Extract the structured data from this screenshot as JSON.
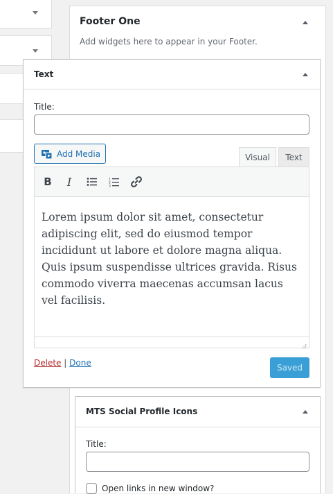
{
  "sidebar": {
    "title": "Footer One",
    "description": "Add widgets here to appear in your Footer."
  },
  "text_widget": {
    "title": "Text",
    "title_label": "Title:",
    "title_value": "",
    "add_media_label": "Add Media",
    "tabs": [
      "Visual",
      "Text"
    ],
    "active_tab": "Visual",
    "toolbar": [
      "bold-icon",
      "italic-icon",
      "bulleted-list-icon",
      "numbered-list-icon",
      "link-icon"
    ],
    "content": "Lorem ipsum dolor sit amet, consectetur adipiscing elit, sed do eiusmod tempor incididunt ut labore et dolore magna aliqua. Quis ipsum suspendisse ultrices gravida. Risus commodo viverra maecenas accumsan lacus vel facilisis.",
    "delete_label": "Delete",
    "separator": "|",
    "done_label": "Done",
    "saved_label": "Saved"
  },
  "mts_widget": {
    "title": "MTS Social Profile Icons",
    "title_label": "Title:",
    "title_value": "",
    "checkbox_label": "Open links in new window?",
    "checkbox_checked": false
  },
  "colors": {
    "accent": "#2271b1",
    "saved_button": "#3a9fd6",
    "delete_link": "#b32d2e",
    "background": "#f1f1f1"
  }
}
